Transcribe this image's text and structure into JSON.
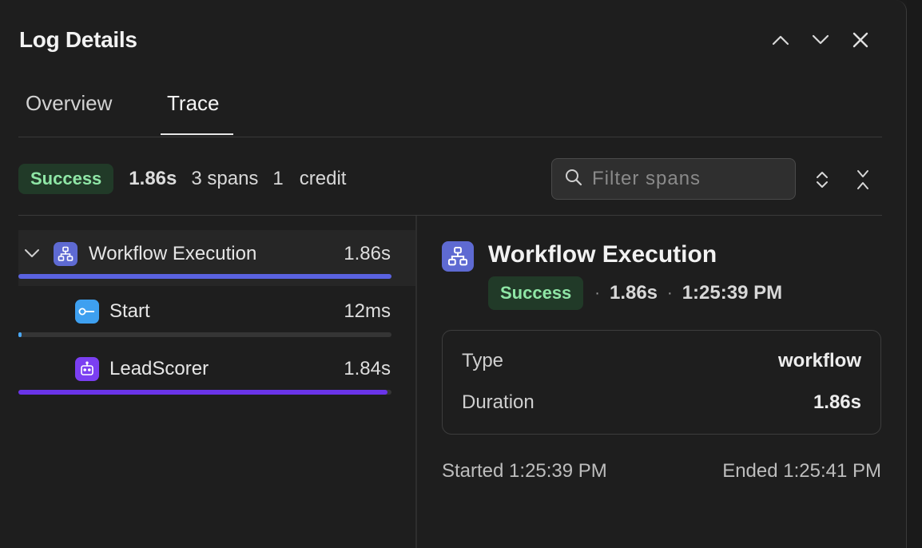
{
  "header": {
    "title": "Log Details",
    "icons": [
      "chevron-up-icon",
      "chevron-down-icon",
      "close-icon"
    ]
  },
  "tabs": [
    {
      "label": "Overview",
      "active": false
    },
    {
      "label": "Trace",
      "active": true
    }
  ],
  "summary": {
    "status": "Success",
    "duration": "1.86s",
    "spans": "3 spans",
    "credits_count": "1",
    "credits_label": "credit"
  },
  "filter": {
    "placeholder": "Filter spans",
    "value": ""
  },
  "spans": [
    {
      "name": "Workflow Execution",
      "duration": "1.86s",
      "icon": "workflow-icon",
      "icon_color": "#5e6ad2",
      "bar_color": "#5a62e0",
      "fraction": 1.0,
      "expanded": true,
      "selected": true
    },
    {
      "name": "Start",
      "duration": "12ms",
      "icon": "start-key-icon",
      "icon_color": "#3ea0f0",
      "bar_color": "#4aa8f5",
      "fraction": 0.0065,
      "selected": false
    },
    {
      "name": "LeadScorer",
      "duration": "1.84s",
      "icon": "robot-icon",
      "icon_color": "#7b3ff2",
      "bar_color": "#6a34e8",
      "fraction": 0.989,
      "selected": false
    }
  ],
  "detail": {
    "title": "Workflow Execution",
    "status": "Success",
    "duration": "1.86s",
    "time": "1:25:39 PM",
    "fields": [
      {
        "label": "Type",
        "value": "workflow"
      },
      {
        "label": "Duration",
        "value": "1.86s"
      }
    ],
    "started": "Started 1:25:39 PM",
    "ended": "Ended 1:25:41 PM"
  },
  "colors": {
    "success_bg": "#213a28",
    "success_text": "#8fe6a6",
    "background": "#1e1e1e"
  }
}
